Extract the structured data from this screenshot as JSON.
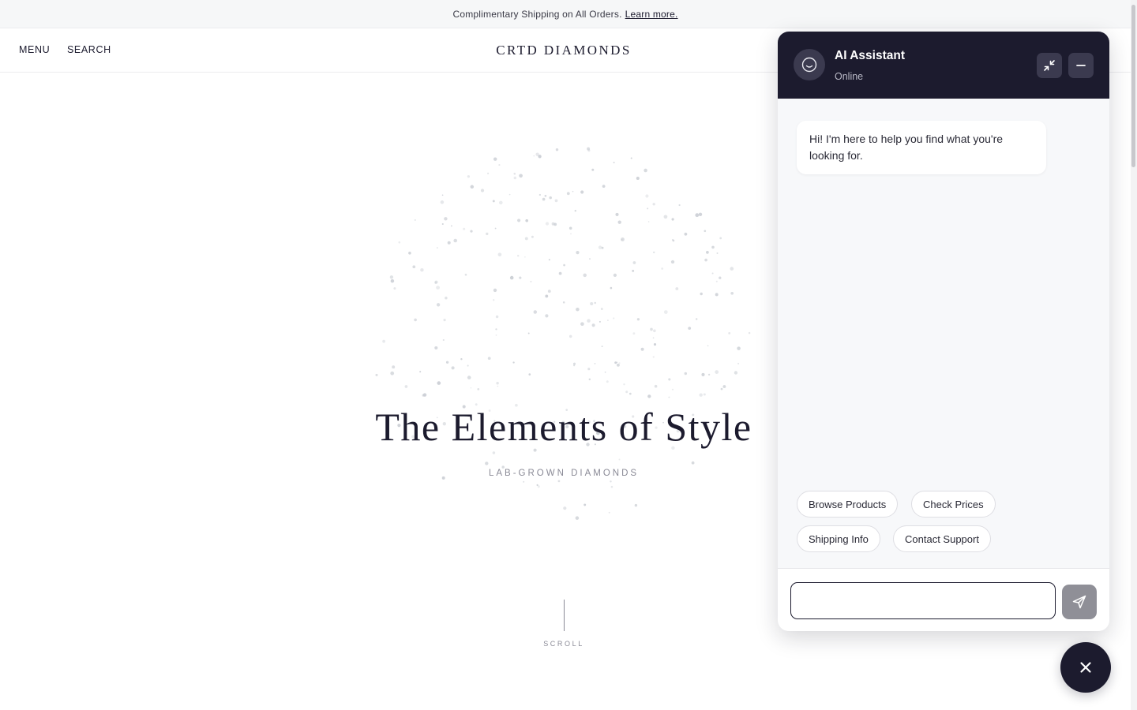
{
  "announcement": {
    "text": "Complimentary Shipping on All Orders.",
    "link_label": "Learn more."
  },
  "nav": {
    "menu_label": "MENU",
    "search_label": "SEARCH",
    "brand": "CRTD DIAMONDS"
  },
  "hero": {
    "title": "The Elements of Style",
    "subtitle": "LAB-GROWN DIAMONDS",
    "scroll_label": "SCROLL"
  },
  "chat": {
    "title": "AI Assistant",
    "status": "Online",
    "greeting": "Hi! I'm here to help you find what you're looking for.",
    "quick_replies": [
      "Browse Products",
      "Check Prices",
      "Shipping Info",
      "Contact Support"
    ],
    "input_value": "",
    "input_placeholder": ""
  },
  "icons": {
    "avatar": "smile-icon",
    "collapse": "collapse-icon",
    "minimize": "minimize-icon",
    "send": "send-icon",
    "close": "close-icon"
  },
  "colors": {
    "brand_dark": "#1c1b2e",
    "header_button": "#3b3a4f",
    "send_button": "#8f8f97",
    "announcement_bg": "#f6f7f8",
    "chat_bg": "#f7f8fa"
  }
}
